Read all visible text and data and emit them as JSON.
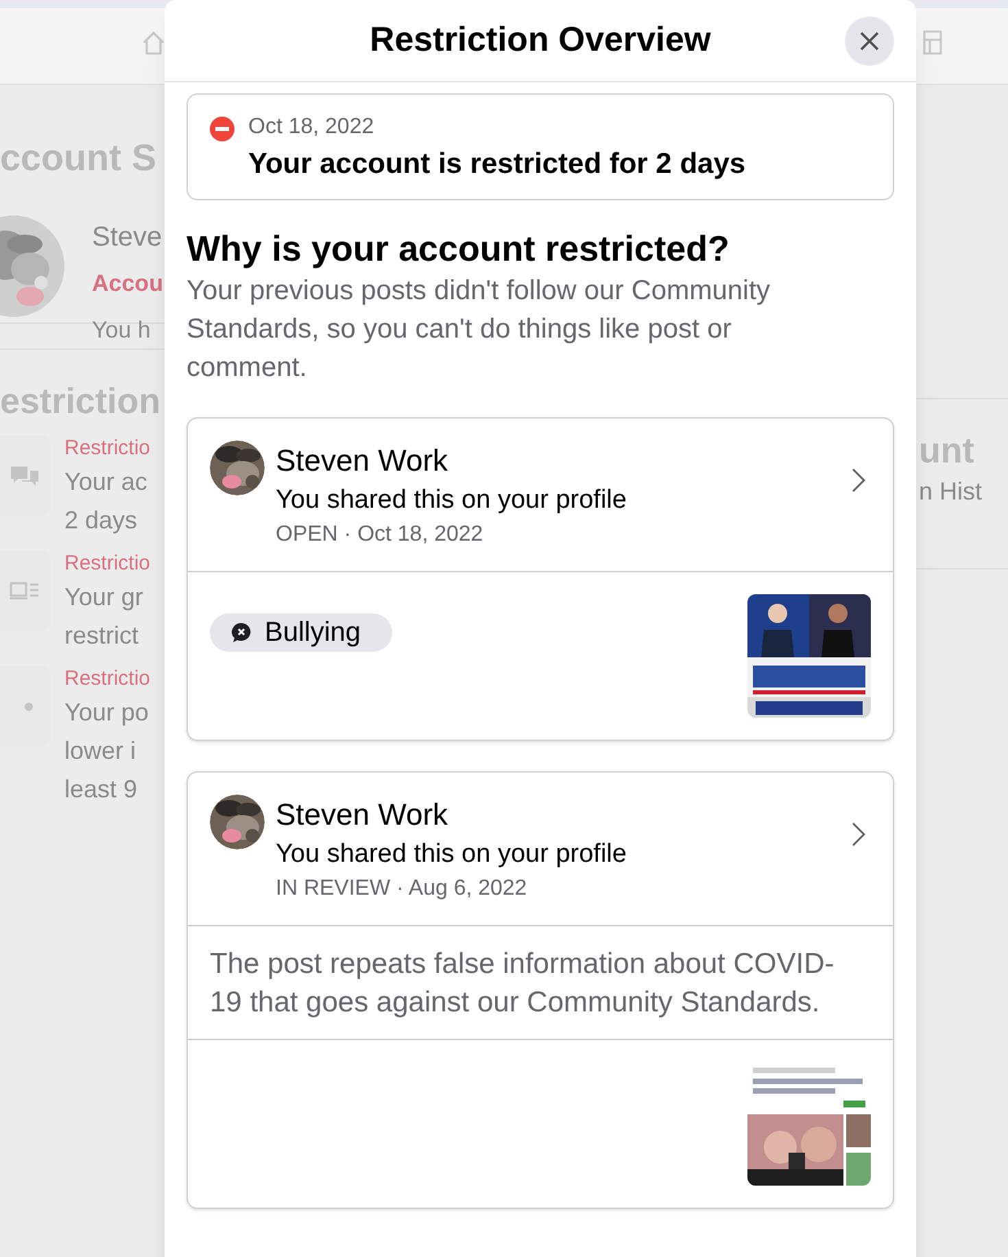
{
  "background": {
    "heading": "ccount S",
    "profile": {
      "name": "Steve",
      "status": "Accou",
      "note": "You h"
    },
    "section_heading": "estriction",
    "items": [
      {
        "title": "Restrictio",
        "lines": [
          "Your ac",
          "2 days"
        ]
      },
      {
        "title": "Restrictio",
        "lines": [
          "Your gr",
          "restrict"
        ]
      },
      {
        "title": "Restrictio",
        "lines": [
          "Your po",
          "lower i",
          "least 9"
        ]
      }
    ],
    "right_heading": "unt",
    "right_link": "n Hist"
  },
  "dialog": {
    "title": "Restriction Overview",
    "notice": {
      "date": "Oct 18, 2022",
      "message": "Your account is restricted for 2 days"
    },
    "heading": "Why is your account restricted?",
    "explanation": "Your previous posts didn't follow our Community Standards, so you can't do things like post or comment.",
    "posts": [
      {
        "kind": "tag",
        "author": "Steven Work",
        "action": "You shared this on your profile",
        "meta": "OPEN · Oct 18, 2022",
        "tag": "Bullying"
      },
      {
        "kind": "reason",
        "author": "Steven Work",
        "action": "You shared this on your profile",
        "meta": "IN REVIEW · Aug 6, 2022",
        "reason": "The post repeats false information about COVID-19 that goes against our Community Standards."
      }
    ]
  }
}
